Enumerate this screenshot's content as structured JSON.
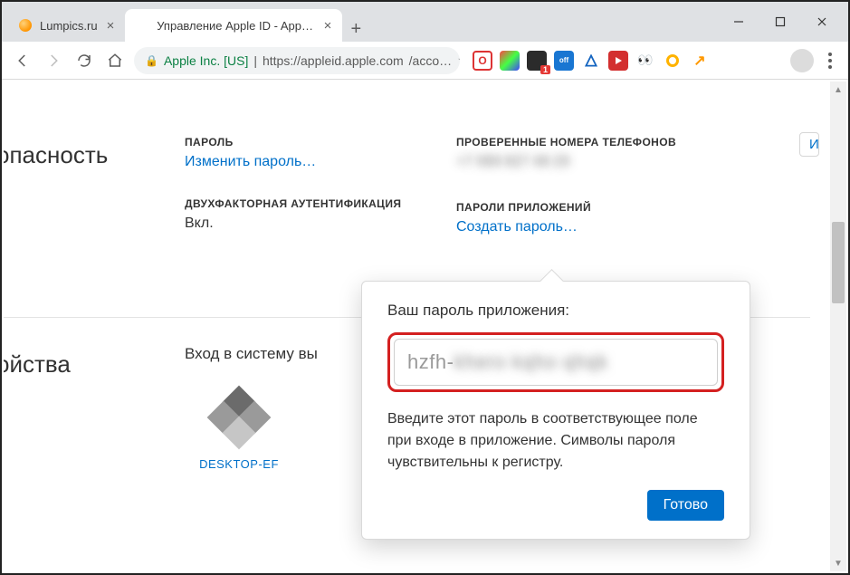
{
  "window": {
    "tabs": [
      {
        "label": "Lumpics.ru",
        "active": false,
        "favicon": "orange"
      },
      {
        "label": "Управление Apple ID - Apple (R",
        "active": true,
        "favicon": "apple"
      }
    ],
    "address": {
      "origin": "Apple Inc. [US]",
      "scheme_host": "https://appleid.apple.com",
      "path": "/acco…"
    }
  },
  "security": {
    "heading": "опасность",
    "password_label": "ПАРОЛЬ",
    "change_password": "Изменить пароль…",
    "twofa_label": "ДВУХФАКТОРНАЯ АУТЕНТИФИКАЦИЯ",
    "twofa_value": "Вкл.",
    "trusted_numbers_label": "ПРОВЕРЕННЫЕ НОМЕРА ТЕЛЕФОНОВ",
    "trusted_number_masked": "+7 999 827 48 29",
    "app_passwords_label": "ПАРОЛИ ПРИЛОЖЕНИЙ",
    "create_password": "Создать пароль…",
    "edit_label": "И"
  },
  "devices": {
    "heading": "ойства",
    "login_text": "Вход в систему вы",
    "device_name": "DESKTOP-EF"
  },
  "popover": {
    "title": "Ваш пароль приложения:",
    "password_visible": "hzfh-",
    "password_hidden": "khero kqho qhqk",
    "help": "Введите этот пароль в соответствующее поле при входе в приложение. Символы пароля чувствительны к регистру.",
    "done": "Готово"
  }
}
